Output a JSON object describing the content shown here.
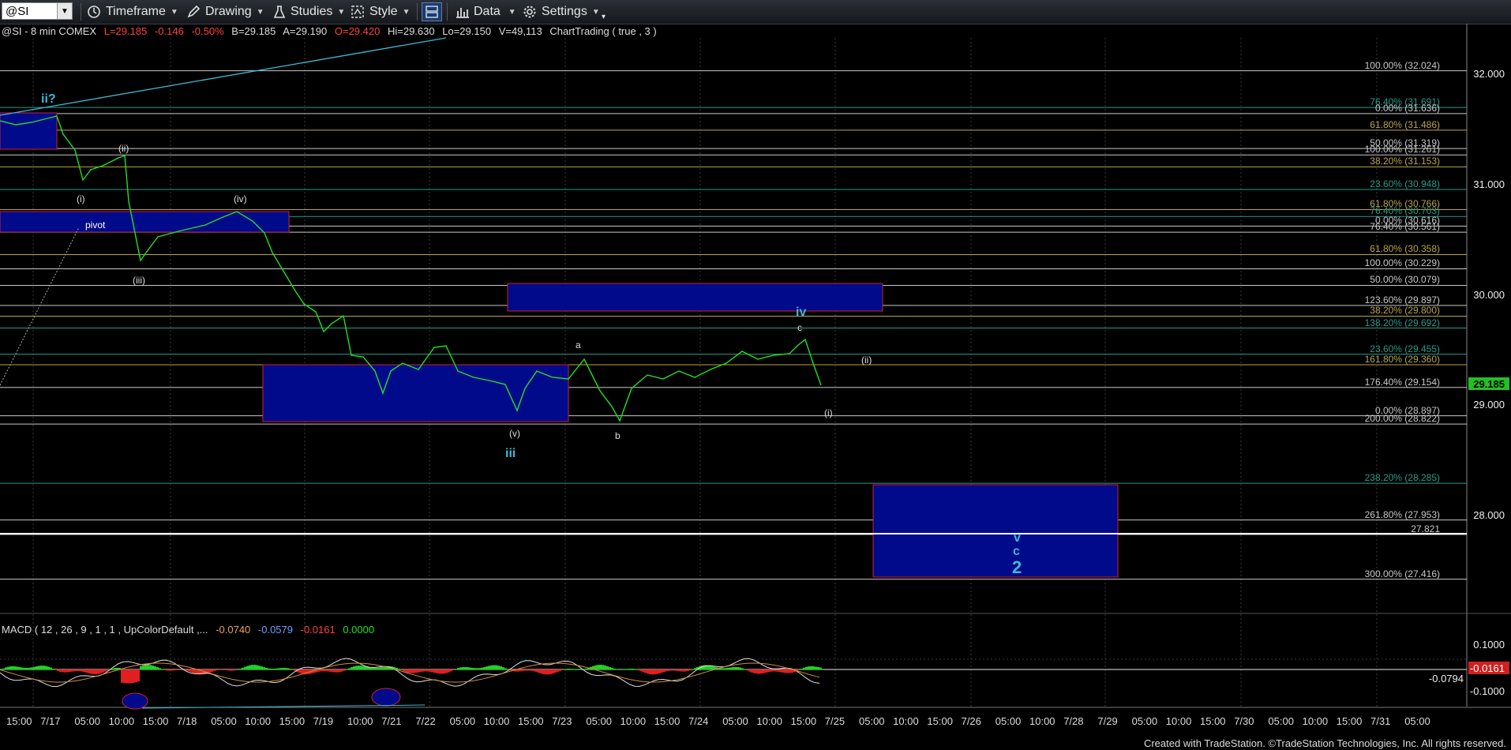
{
  "toolbar": {
    "symbol": "@SI",
    "timeframe": "Timeframe",
    "drawing": "Drawing",
    "studies": "Studies",
    "style": "Style",
    "data": "Data",
    "settings": "Settings"
  },
  "header": {
    "symbol_info": "@SI - 8 min  COMEX",
    "last": "L=29.185",
    "change": "-0.146",
    "pct": "-0.50%",
    "bid": "B=29.185",
    "ask": "A=29.190",
    "open": "O=29.420",
    "high": "Hi=29.630",
    "low": "Lo=29.150",
    "volume": "V=49,113",
    "study": "ChartTrading ( true , 3 )"
  },
  "fib_levels": [
    {
      "label": "100.00% (32.024)",
      "color": "#c8c8c8"
    },
    {
      "label": "76.40% (31.691)",
      "color": "#2a9a8a"
    },
    {
      "label": "0.00% (31.636)",
      "color": "#c8c8c8"
    },
    {
      "label": "61.80% (31.486)",
      "color": "#b8a44c"
    },
    {
      "label": "50.00% (31.319)",
      "color": "#c8c8c8"
    },
    {
      "label": "100.00% (31.261)",
      "color": "#c8c8c8"
    },
    {
      "label": "38.20% (31.153)",
      "color": "#b8a44c"
    },
    {
      "label": "23.60% (30.948)",
      "color": "#2a9a8a"
    },
    {
      "label": "61.80% (30.766)",
      "color": "#b8a44c"
    },
    {
      "label": "76.40% (30.703)",
      "color": "#2a9a8a"
    },
    {
      "label": "0.00% (30.616)",
      "color": "#c8c8c8"
    },
    {
      "label": "76.40% (30.561)",
      "color": "#c8c8c8"
    },
    {
      "label": "61.80% (30.358)",
      "color": "#b8a44c"
    },
    {
      "label": "100.00% (30.229)",
      "color": "#c8c8c8"
    },
    {
      "label": "50.00% (30.079)",
      "color": "#c8c8c8"
    },
    {
      "label": "123.60% (29.897)",
      "color": "#c8c8c8"
    },
    {
      "label": "38.20% (29.800)",
      "color": "#b8a44c"
    },
    {
      "label": "138.20% (29.692)",
      "color": "#2a9a8a"
    },
    {
      "label": "23.60% (29.455)",
      "color": "#2a9a8a"
    },
    {
      "label": "161.80% (29.360)",
      "color": "#b8a44c"
    },
    {
      "label": "176.40% (29.154)",
      "color": "#c8c8c8"
    },
    {
      "label": "0.00% (28.897)",
      "color": "#c8c8c8"
    },
    {
      "label": "200.00% (28.822)",
      "color": "#c8c8c8"
    },
    {
      "label": "238.20% (28.285)",
      "color": "#2a9a8a"
    },
    {
      "label": "261.80% (27.953)",
      "color": "#c8c8c8"
    },
    {
      "label": "27.821",
      "color": "#c8c8c8"
    },
    {
      "label": "300.00% (27.416)",
      "color": "#c8c8c8"
    }
  ],
  "price_axis": [
    "32.000",
    "31.000",
    "30.000",
    "29.000",
    "28.000"
  ],
  "last_price": "29.185",
  "macd": {
    "label": "MACD ( 12 , 26 , 9 , 1 , 1 , UpColorDefault ,...",
    "v1": "-0.0740",
    "v2": "-0.0579",
    "v3": "-0.0161",
    "v4": "0.0000",
    "axis_top": "0.1000",
    "axis_bottom": "-0.1000",
    "level": "-0.0794",
    "last": "-0.0161"
  },
  "time_axis": [
    "15:00",
    "7/17",
    "05:00",
    "10:00",
    "15:00",
    "7/18",
    "05:00",
    "10:00",
    "15:00",
    "7/19",
    "10:00",
    "7/21",
    "7/22",
    "05:00",
    "10:00",
    "15:00",
    "7/23",
    "05:00",
    "10:00",
    "15:00",
    "7/24",
    "05:00",
    "10:00",
    "15:00",
    "7/25",
    "05:00",
    "10:00",
    "15:00",
    "7/26",
    "05:00",
    "10:00",
    "7/28",
    "7/29",
    "05:00",
    "10:00",
    "15:00",
    "7/30",
    "05:00",
    "10:00",
    "15:00",
    "7/31",
    "05:00"
  ],
  "waves": {
    "ii_q": "ii?",
    "w_ii": "(ii)",
    "w_i": "(i)",
    "w_iv": "(iv)",
    "pivot": "pivot",
    "w_iii": "(iii)",
    "w_v": "(v)",
    "iii": "iii",
    "a": "a",
    "b": "b",
    "c": "c",
    "iv": "iv",
    "p_ii": "(ii)",
    "p_i": "(i)",
    "v": "v",
    "c2": "c",
    "two": "2"
  },
  "footer": "Created with TradeStation. ©TradeStation Technologies, Inc. All rights reserved.",
  "colors": {
    "price_line": "#22e022",
    "box_fill": "#000a8a",
    "box_border": "#d02030",
    "wave_blue": "#3fb8d6"
  }
}
